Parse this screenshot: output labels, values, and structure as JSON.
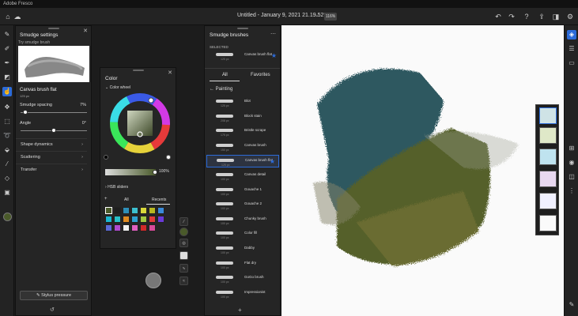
{
  "app": {
    "name": "Adobe Fresco"
  },
  "topbar": {
    "doc_title": "Untitled - January 9, 2021 21.19.52*",
    "zoom": "116%"
  },
  "smudge_settings": {
    "title": "Smudge settings",
    "try_label": "Try smudge brush",
    "brush_name": "Canvas brush flat",
    "brush_size": "125 px",
    "spacing_label": "Smudge spacing",
    "spacing_value": "7%",
    "spacing_level": 0.07,
    "angle_label": "Angle",
    "angle_value": "0°",
    "angle_level": 0.5,
    "sections": [
      "Shape dynamics",
      "Scattering",
      "Transfer"
    ],
    "stylus_button": "Stylus pressure"
  },
  "color_panel": {
    "title": "Color",
    "wheel_label": "Color wheel",
    "opacity_value": "100%",
    "hsb_label": "HSB sliders",
    "tabs": [
      "All",
      "Recents"
    ],
    "swatches": [
      "#4a5a2a",
      "#1e1e1e",
      "#2e8fb8",
      "#3cbfcf",
      "#d8d83a",
      "#b8b820",
      "#3a8ad8",
      "#1ab6d0",
      "#27c0c8",
      "#e08a20",
      "#2ea0d0",
      "#a0c840",
      "#e03a3a",
      "#6a3ad8",
      "#5a6ad8",
      "#b04ad0",
      "#f0f0f0",
      "#e060c0",
      "#d02a2a",
      "#d84a9a"
    ],
    "selected_swatch": "#4a5a2a"
  },
  "brushes_panel": {
    "title": "Smudge brushes",
    "selected_label": "SELECTED",
    "selected_brush": {
      "name": "Canvas brush flat",
      "size": "125 px"
    },
    "tabs": {
      "all": "All",
      "favorites": "Favorites"
    },
    "category": "Painting",
    "brushes": [
      {
        "name": "Blot",
        "size": "125 px"
      },
      {
        "name": "Block stain",
        "size": "208 px"
      },
      {
        "name": "Bristle scrape",
        "size": "175 px"
      },
      {
        "name": "Canvas brush",
        "size": "150 px"
      },
      {
        "name": "Canvas brush flat",
        "size": "125 px"
      },
      {
        "name": "Canvas detail",
        "size": "100 px"
      },
      {
        "name": "Gouache 1",
        "size": "100 px"
      },
      {
        "name": "Gouache 2",
        "size": "100 px"
      },
      {
        "name": "Chunky brush",
        "size": "100 px"
      },
      {
        "name": "Color fill",
        "size": "100 px"
      },
      {
        "name": "Dabby",
        "size": "100 px"
      },
      {
        "name": "Flat dry",
        "size": "100 px"
      },
      {
        "name": "GoGo brush",
        "size": "100 px"
      },
      {
        "name": "Impressionist",
        "size": "100 px"
      }
    ],
    "selected_index": 4
  },
  "colors": {
    "accent": "#2c6bd9",
    "panel": "#252525",
    "canvas": "#fafafa"
  }
}
